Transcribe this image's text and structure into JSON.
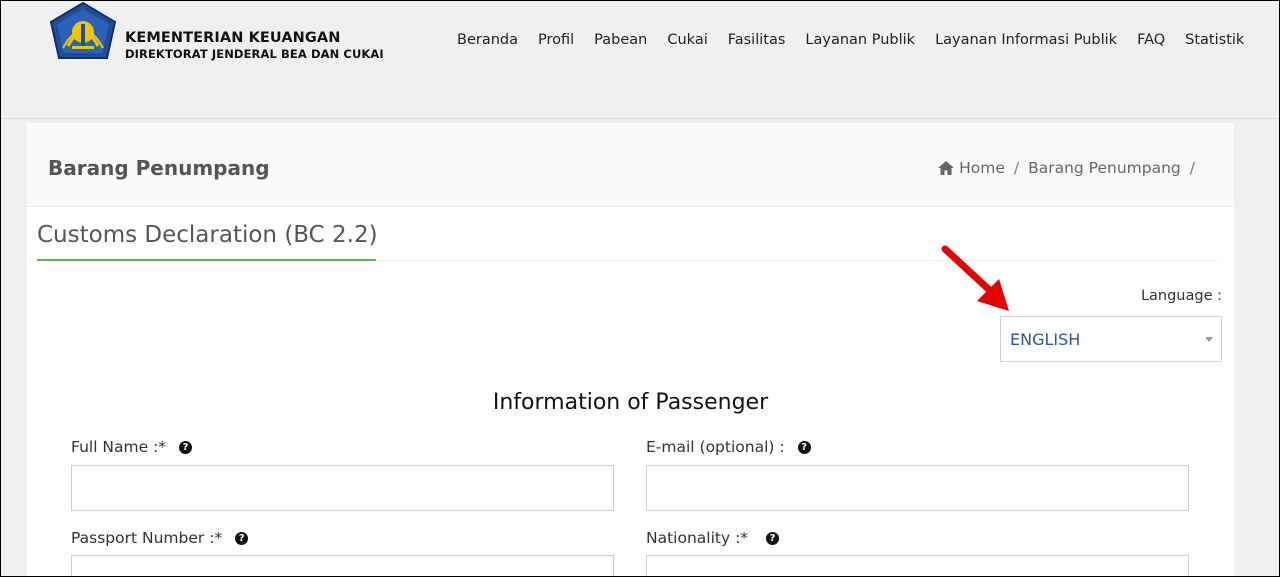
{
  "header": {
    "brand_title": "KEMENTERIAN KEUANGAN",
    "brand_subtitle": "DIREKTORAT JENDERAL BEA DAN CUKAI",
    "nav": [
      "Beranda",
      "Profil",
      "Pabean",
      "Cukai",
      "Fasilitas",
      "Layanan Publik",
      "Layanan Informasi Publik",
      "FAQ",
      "Statistik"
    ]
  },
  "page": {
    "title": "Barang Penumpang",
    "breadcrumb": {
      "home": "Home",
      "current": "Barang Penumpang",
      "separator": "/"
    }
  },
  "form": {
    "section_title": "Customs Declaration (BC 2.2)",
    "language_label": "Language :",
    "language_value": "ENGLISH",
    "passenger_title": "Information of Passenger",
    "fields": {
      "full_name": "Full Name :*",
      "email": "E-mail (optional) :",
      "passport": "Passport Number :*",
      "nationality": "Nationality :*"
    },
    "help_glyph": "?"
  },
  "colors": {
    "accent_green": "#5cb85c",
    "annotation_arrow": "#e60000",
    "language_text": "#2a5a8c"
  },
  "icons": {
    "home": "home-icon",
    "help": "question-circle-icon",
    "annotation": "red-arrow-icon"
  }
}
